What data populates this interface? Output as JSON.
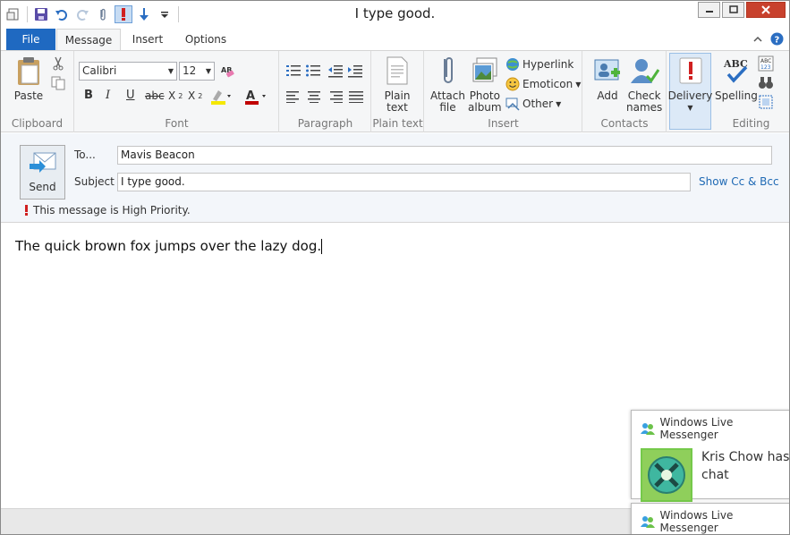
{
  "window": {
    "title": "I type good."
  },
  "tabs": [
    {
      "label": "File"
    },
    {
      "label": "Message"
    },
    {
      "label": "Insert"
    },
    {
      "label": "Options"
    }
  ],
  "ribbon": {
    "clipboard": {
      "paste": "Paste",
      "label": "Clipboard"
    },
    "font": {
      "family": "Calibri",
      "size": "12",
      "label": "Font"
    },
    "paragraph": {
      "label": "Paragraph"
    },
    "plaintext": {
      "btn_line1": "Plain",
      "btn_line2": "text",
      "label": "Plain text"
    },
    "insert": {
      "attach_line1": "Attach",
      "attach_line2": "file",
      "photo_line1": "Photo",
      "photo_line2": "album",
      "hyperlink": "Hyperlink",
      "emoticon": "Emoticon",
      "other": "Other",
      "label": "Insert"
    },
    "contacts": {
      "add": "Add",
      "check_line1": "Check",
      "check_line2": "names",
      "label": "Contacts"
    },
    "delivery": {
      "label": "Delivery"
    },
    "editing": {
      "spelling": "Spelling",
      "label": "Editing"
    }
  },
  "header": {
    "send": "Send",
    "to_label": "To...",
    "to_value": "Mavis Beacon",
    "subject_label": "Subject",
    "subject_value": "I type good.",
    "show_cc": "Show Cc & Bcc",
    "priority_note": "This message is High Priority."
  },
  "body": {
    "text": "The quick brown fox jumps over the lazy dog."
  },
  "toasts": [
    {
      "app": "Windows Live Messenger",
      "line1": "Kris Chow has j",
      "line2": "chat"
    },
    {
      "app": "Windows Live Messenger"
    }
  ],
  "colors": {
    "file_tab": "#1f69c1",
    "link": "#1e69b4",
    "priority": "#d02020",
    "close": "#c8412d"
  }
}
